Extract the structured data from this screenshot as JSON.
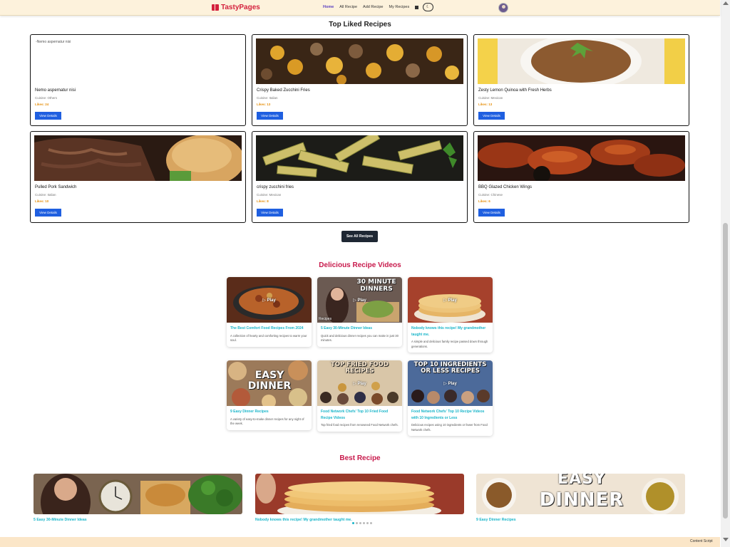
{
  "navbar": {
    "brand": "TastyPages",
    "links": [
      "Home",
      "All Recipe",
      "Add Recipe",
      "My Recipes"
    ],
    "active": "Home",
    "theme_icon": "moon-icon"
  },
  "top_liked": {
    "title": "Top Liked Recipes",
    "view_label": "View Details",
    "see_all_label": "See All Recipes",
    "cards": [
      {
        "name": "Nemo aspernatur nisi",
        "cuisine": "Cuisine: Others",
        "likes": "Likes: 24",
        "image_alt": "Nemo aspernatur nisi",
        "image": "broken"
      },
      {
        "name": "Crispy Baked Zucchini Fries",
        "cuisine": "Cuisine: Italian",
        "likes": "Likes: 13",
        "image": "potatoes-mushrooms"
      },
      {
        "name": "Zesty Lemon Quinoa with Fresh Herbs",
        "cuisine": "Cuisine: Mexican",
        "likes": "Likes: 13",
        "image": "quinoa-bowl"
      },
      {
        "name": "Pulled Pork Sandwich",
        "cuisine": "Cuisine: Italian",
        "likes": "Likes: 10",
        "image": "pulled-pork"
      },
      {
        "name": "crispy zucchini fries",
        "cuisine": "Cuisine: Mexican",
        "likes": "Likes: 8",
        "image": "zucchini-fries"
      },
      {
        "name": "BBQ Glazed Chicken Wings",
        "cuisine": "Cuisine: Chinese",
        "likes": "Likes: 6",
        "image": "chicken-wings"
      }
    ]
  },
  "videos": {
    "title": "Delicious Recipe Videos",
    "play_label": "▷ Play",
    "items": [
      {
        "title": "The Best Comfort Food Recipes From 2024",
        "desc": "A collection of hearty and comforting recipes to warm your soul."
      },
      {
        "title": "5 Easy 30-Minute Dinner Ideas",
        "desc": "Quick and delicious dinner recipes you can make in just 30 minutes.",
        "overlay": "30 MINUTE DINNERS",
        "tag": "Recipes"
      },
      {
        "title": "Nobody knows this recipe! My grandmother taught me.",
        "desc": "A simple and delicious family recipe passed down through generations."
      },
      {
        "title": "9 Easy Dinner Recipes",
        "desc": "A variety of easy-to-make dinner recipes for any night of the week.",
        "overlay1": "EASY",
        "overlay2": "DINNER"
      },
      {
        "title": "Food Network Chefs' Top 10 Fried Food Recipe Videos",
        "desc": "Top fried food recipes from renowned Food Network chefs.",
        "overlay": "TOP FRIED FOOD RECIPES"
      },
      {
        "title": "Food Network Chefs' Top 10 Recipe Videos with 10 Ingredients or Less",
        "desc": "Delicious recipes using 10 ingredients or fewer from Food Network chefs.",
        "overlay": "TOP 10 INGREDIENTS OR LESS RECIPES"
      }
    ]
  },
  "best": {
    "title": "Best Recipe",
    "items": [
      {
        "title": "5 Easy 30-Minute Dinner Ideas"
      },
      {
        "title": "Nobody knows this recipe! My grandmother taught me."
      },
      {
        "title": "9 Easy Dinner Recipes",
        "overlay1": "EASY",
        "overlay2": "DINNER"
      }
    ],
    "active_dot": 0,
    "dot_count": 6
  },
  "footer": {
    "content_script": "Content Script"
  },
  "colors": {
    "accent": "#c8194b",
    "brand": "#d4213d",
    "button": "#1f5fe0",
    "likes": "#e6900e",
    "video_title": "#19b5c9"
  }
}
